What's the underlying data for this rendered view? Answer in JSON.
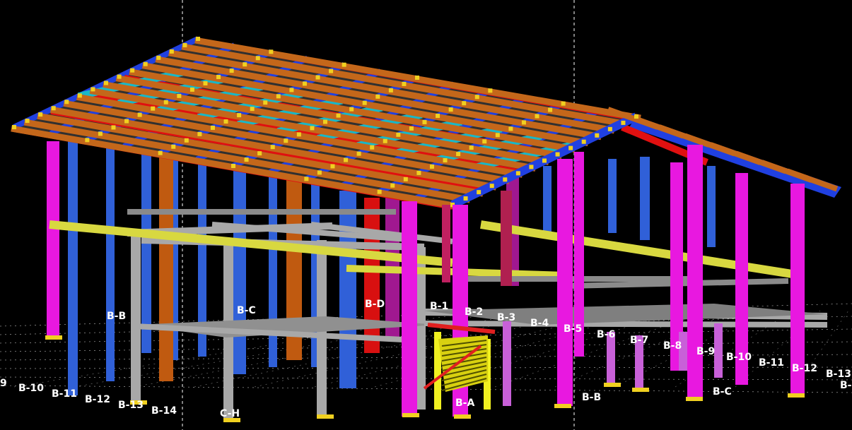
{
  "viewport": {
    "background": "#000000",
    "colors": {
      "roof_purlin": "#c4671a",
      "roof_beam": "#2040e0",
      "rafter": "#e01010",
      "bracing": "#18b8c8",
      "column_main": "#e818e0",
      "column_back": "#a01890",
      "column_blue": "#3060d8",
      "column_orange": "#c05a10",
      "column_red": "#d81010",
      "frame_gray": "#a8a8a8",
      "beam_yellow": "#d8d840",
      "short_column": "#c860d8",
      "stair": "#f0f020",
      "connection": "#f0d020",
      "grid_line": "#ffffff"
    },
    "grid_labels": [
      "9",
      "B-10",
      "B-11",
      "B-12",
      "B-13",
      "B-14",
      "C-H",
      "B-B",
      "B-C",
      "B-D",
      "B-1",
      "B-2",
      "B-3",
      "B-4",
      "B-5",
      "B-6",
      "B-7",
      "B-8",
      "B-9",
      "B-10",
      "B-11",
      "B-12",
      "B-13",
      "B-",
      "B-A",
      "B-B",
      "B-C"
    ]
  }
}
